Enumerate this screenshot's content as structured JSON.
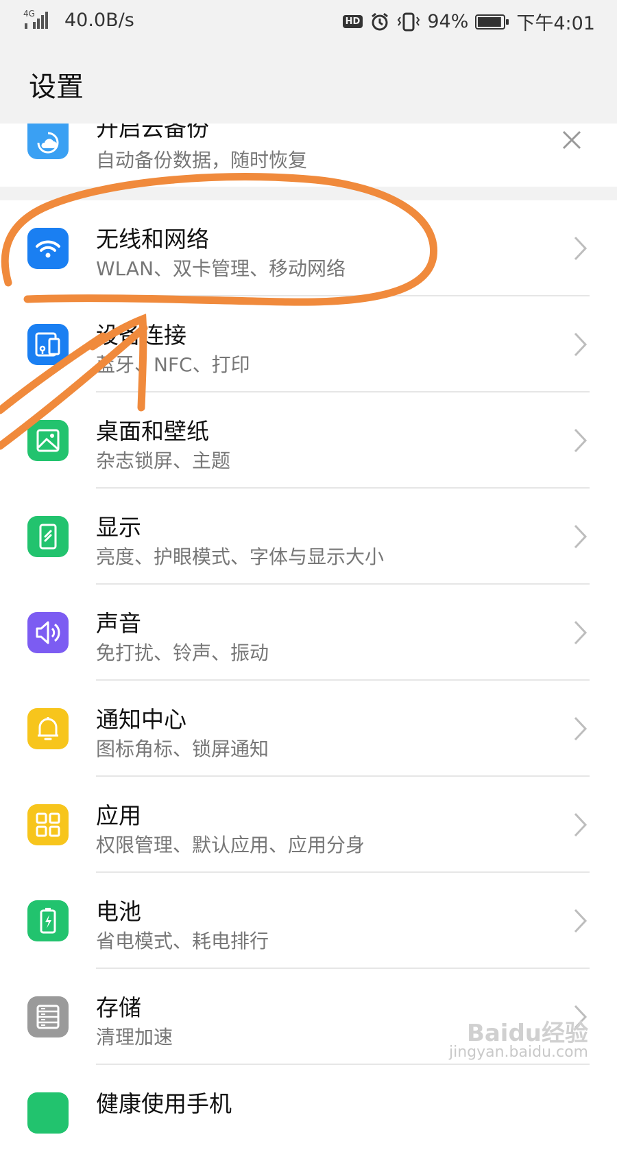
{
  "status_bar": {
    "network": "4G",
    "speed": "40.0B/s",
    "hd_badge": "HD",
    "battery_percent": "94%",
    "battery_level": 0.94,
    "time": "下午4:01"
  },
  "header": {
    "title": "设置"
  },
  "backup_card": {
    "title": "开启云备份",
    "subtitle": "自动备份数据，随时恢复"
  },
  "colors": {
    "blue": "#1a7ff2",
    "green": "#22c36e",
    "purple": "#7c5cf2",
    "yellow": "#f7c51c",
    "gray": "#9a9a9a",
    "annotation": "#f08a3c"
  },
  "settings": [
    {
      "title": "无线和网络",
      "subtitle": "WLAN、双卡管理、移动网络",
      "icon": "wifi-icon"
    },
    {
      "title": "设备连接",
      "subtitle": "蓝牙、NFC、打印",
      "icon": "device-connect-icon"
    },
    {
      "title": "桌面和壁纸",
      "subtitle": "杂志锁屏、主题",
      "icon": "wallpaper-icon"
    },
    {
      "title": "显示",
      "subtitle": "亮度、护眼模式、字体与显示大小",
      "icon": "display-icon"
    },
    {
      "title": "声音",
      "subtitle": "免打扰、铃声、振动",
      "icon": "sound-icon"
    },
    {
      "title": "通知中心",
      "subtitle": "图标角标、锁屏通知",
      "icon": "bell-icon"
    },
    {
      "title": "应用",
      "subtitle": "权限管理、默认应用、应用分身",
      "icon": "apps-icon"
    },
    {
      "title": "电池",
      "subtitle": "省电模式、耗电排行",
      "icon": "battery-icon"
    },
    {
      "title": "存储",
      "subtitle": "清理加速",
      "icon": "storage-icon"
    },
    {
      "title": "健康使用手机",
      "subtitle": "",
      "icon": "health-icon"
    }
  ],
  "watermark": {
    "brand": "Baidu经验",
    "url": "jingyan.baidu.com"
  }
}
